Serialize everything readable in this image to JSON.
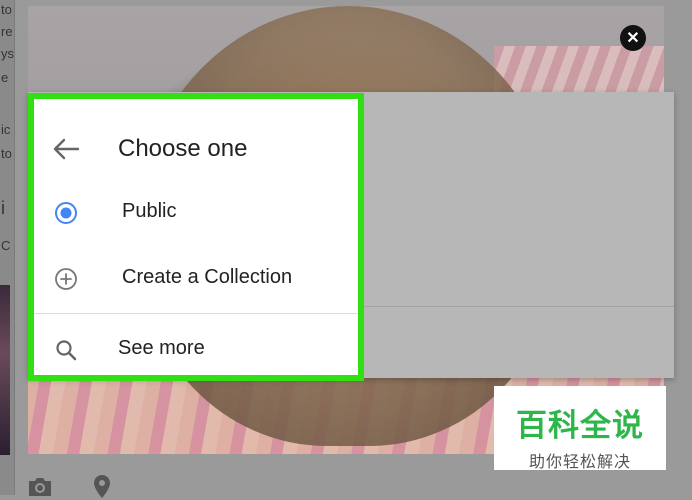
{
  "background": {
    "left_text_fragments": [
      "to",
      "re",
      "ys",
      "e",
      "ic",
      "to",
      "i",
      "C"
    ]
  },
  "menu": {
    "title": "Choose one",
    "back_icon": "arrow-left-icon",
    "items": [
      {
        "label": "Public",
        "icon": "radio-selected-icon",
        "selected": true
      },
      {
        "label": "Create a Collection",
        "icon": "add-circle-icon",
        "selected": false
      }
    ],
    "see_more": {
      "label": "See more",
      "icon": "search-icon"
    }
  },
  "close_icon": "close-icon",
  "bottom_toolbar": {
    "icons": [
      "camera-icon",
      "location-pin-icon"
    ]
  },
  "watermark": {
    "title": "百科全说",
    "subtitle": "助你轻松解决"
  },
  "colors": {
    "highlight_border": "#31e013",
    "radio_selected": "#4285f4",
    "watermark_green": "#2fb64a"
  }
}
